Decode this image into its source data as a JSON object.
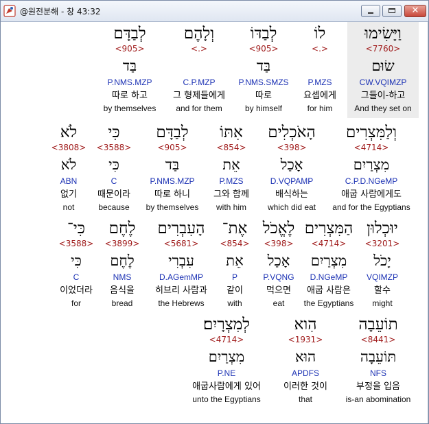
{
  "window": {
    "title": "@원전분해 - 창 43:32",
    "close_glyph": "✕"
  },
  "rows": [
    {
      "words": [
        {
          "heb": "וַיָּשִׂימוּ",
          "strong": "<7760>",
          "lemma": "שׂוּם",
          "parse": "CW.VQIMZP",
          "ko": "그들이-하고",
          "en": "And they set on",
          "highlight": true
        },
        {
          "heb": "לוֹ",
          "strong": "<.>",
          "lemma": "",
          "parse": "P.MZS",
          "ko": "요셉에게",
          "en": "for him"
        },
        {
          "heb": "לְבַדּוֹ",
          "strong": "<905>",
          "lemma": "בַּד",
          "parse": "P.NMS.SMZS",
          "ko": "따로",
          "en": "by himself"
        },
        {
          "heb": "וְלָהֶם",
          "strong": "<.>",
          "lemma": "",
          "parse": "C.P.MZP",
          "ko": "그 형제들에게",
          "en": "and for them"
        },
        {
          "heb": "לְבַדָּם",
          "strong": "<905>",
          "lemma": "בַּד",
          "parse": "P.NMS.MZP",
          "ko": "따로 하고",
          "en": "by themselves"
        }
      ]
    },
    {
      "words": [
        {
          "heb": "וְלַמִּצְרִים",
          "strong": "<4714>",
          "lemma": "מִצְרַיִם",
          "parse": "C.P.D.NGeMP",
          "ko": "애굽 사람에게도",
          "en": "and for the Egyptians"
        },
        {
          "heb": "הָאֹכְלִים",
          "strong": "<398>",
          "lemma": "אָכַל",
          "parse": "D.VQPAMP",
          "ko": "배식하는",
          "en": "which did eat"
        },
        {
          "heb": "אִתּוֹ",
          "strong": "<854>",
          "lemma": "אֵת",
          "parse": "P.MZS",
          "ko": "그와 함께",
          "en": "with him"
        },
        {
          "heb": "לְבַדָּם",
          "strong": "<905>",
          "lemma": "בַּד",
          "parse": "P.NMS.MZP",
          "ko": "따로 하니",
          "en": "by themselves"
        },
        {
          "heb": "כִּי",
          "strong": "<3588>",
          "lemma": "כִּי",
          "parse": "C",
          "ko": "때문이라",
          "en": "because"
        },
        {
          "heb": "לֹא",
          "strong": "<3808>",
          "lemma": "לֹא",
          "parse": "ABN",
          "ko": "없기",
          "en": "not"
        }
      ]
    },
    {
      "words": [
        {
          "heb": "יוּכְלוּן",
          "strong": "<3201>",
          "lemma": "יָכֹל",
          "parse": "VQIMZP",
          "ko": "할수",
          "en": "might"
        },
        {
          "heb": "הַמִּצְרִים",
          "strong": "<4714>",
          "lemma": "מִצְרַיִם",
          "parse": "D.NGeMP",
          "ko": "애굽 사람은",
          "en": "the Egyptians"
        },
        {
          "heb": "לֶאֱכֹל",
          "strong": "<398>",
          "lemma": "אָכַל",
          "parse": "P.VQNG",
          "ko": "먹으면",
          "en": "eat"
        },
        {
          "heb": "אֶת־",
          "strong": "<854>",
          "lemma": "אֵת",
          "parse": "P",
          "ko": "같이",
          "en": "with"
        },
        {
          "heb": "הָעִבְרִים",
          "strong": "<5681>",
          "lemma": "עִבְרִי",
          "parse": "D.AGemMP",
          "ko": "히브리 사람과",
          "en": "the Hebrews"
        },
        {
          "heb": "לֶחֶם",
          "strong": "<3899>",
          "lemma": "לֶחֶם",
          "parse": "NMS",
          "ko": "음식을",
          "en": "bread"
        },
        {
          "heb": "כִּי־",
          "strong": "<3588>",
          "lemma": "כִּי",
          "parse": "C",
          "ko": "이었더라",
          "en": "for"
        }
      ]
    },
    {
      "words": [
        {
          "heb": "תוֹעֵבָה",
          "strong": "<8441>",
          "lemma": "תּוֹעֵבָה",
          "parse": "NFS",
          "ko": "부정을 입음",
          "en": "is-an abomination"
        },
        {
          "heb": "הִוא",
          "strong": "<1931>",
          "lemma": "הוּא",
          "parse": "APDFS",
          "ko": "이러한 것이",
          "en": "that"
        },
        {
          "heb": "לְמִצְרָיִם׃",
          "strong": "<4714>",
          "lemma": "מִצְרַיִם",
          "parse": "P.NE",
          "ko": "애굽사람에게 있어",
          "en": "unto the Egyptians"
        }
      ]
    }
  ]
}
